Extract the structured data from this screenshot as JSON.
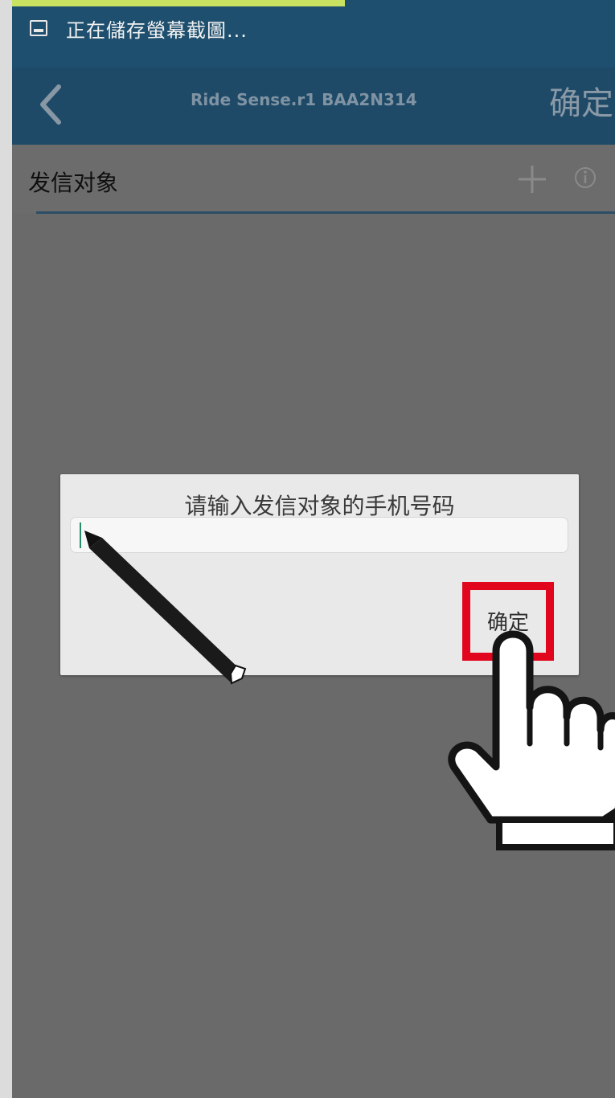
{
  "status_bar": {
    "notification_text": "正在儲存螢幕截圖...",
    "icon": "screenshot-icon"
  },
  "app_bar": {
    "back_icon": "chevron-left-icon",
    "title": "Ride Sense.r1 BAA2N314",
    "confirm_label": "确定"
  },
  "section": {
    "title": "发信对象",
    "add_icon": "plus-icon",
    "info_icon": "info-icon"
  },
  "dialog": {
    "title": "请输入发信对象的手机号码",
    "phone_input_value": "",
    "phone_input_placeholder": "",
    "confirm_label": "确定"
  },
  "annotations": {
    "pencil_icon": "pencil-icon",
    "pointer_icon": "hand-pointer-icon",
    "highlight_color": "#e1061d"
  },
  "colors": {
    "app_bar": "#1e4a68",
    "overlay": "#6a6a6a",
    "dialog": "#e9e9e9"
  }
}
